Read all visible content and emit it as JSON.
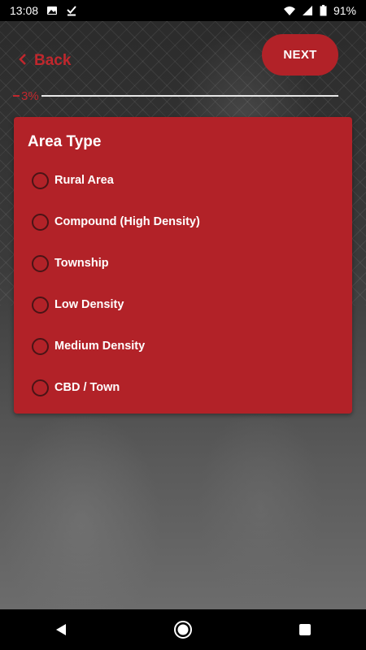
{
  "status_bar": {
    "time": "13:08",
    "battery": "91%",
    "icons": [
      "image-icon",
      "download-done-icon",
      "wifi-icon",
      "signal-icon",
      "battery-icon"
    ]
  },
  "header": {
    "back_label": "Back",
    "next_label": "NEXT"
  },
  "progress": {
    "percent": 3,
    "label": "3%"
  },
  "card": {
    "title": "Area Type",
    "options": [
      {
        "label": "Rural Area",
        "selected": false
      },
      {
        "label": "Compound (High Density)",
        "selected": false
      },
      {
        "label": "Township",
        "selected": false
      },
      {
        "label": "Low Density",
        "selected": false
      },
      {
        "label": "Medium Density",
        "selected": false
      },
      {
        "label": "CBD / Town",
        "selected": false
      }
    ]
  },
  "colors": {
    "accent": "#b22228",
    "accent_text": "#c0272d"
  },
  "nav_bar": {
    "icons": [
      "back-triangle-icon",
      "home-circle-icon",
      "recents-square-icon"
    ]
  }
}
